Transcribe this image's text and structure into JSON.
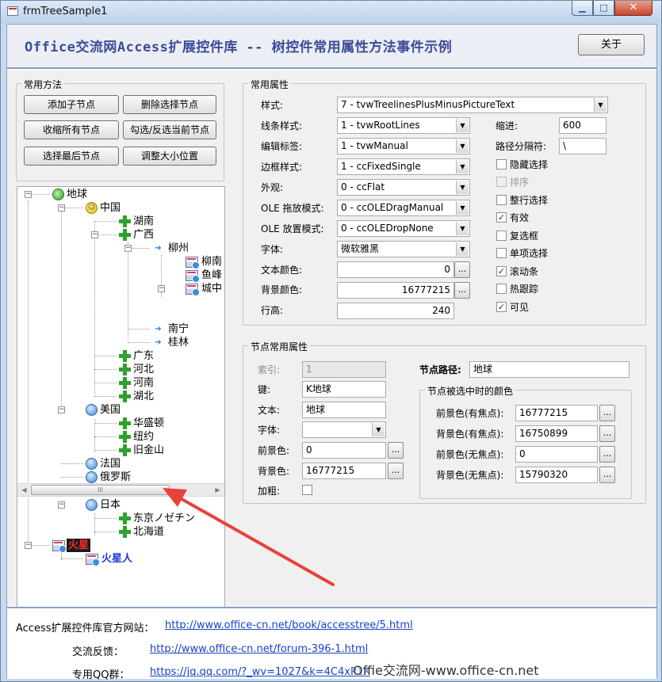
{
  "window": {
    "title": "frmTreeSample1",
    "min_label": "▁",
    "max_label": "□",
    "close_label": "✕"
  },
  "header": {
    "title": "Office交流网Access扩展控件库 -- 树控件常用属性方法事件示例",
    "close_button": "关于"
  },
  "methods": {
    "legend": "常用方法",
    "buttons": [
      "添加子节点",
      "删除选择节点",
      "收缩所有节点",
      "勾选/反选当前节点",
      "选择最后节点",
      "调整大小位置"
    ]
  },
  "tree": {
    "nodes": [
      {
        "label": "地球",
        "icon": "earth-icon",
        "expander": "−"
      },
      {
        "label": "中国",
        "icon": "smile-icon",
        "expander": "−"
      },
      {
        "label": "湖南",
        "icon": "plus-icon"
      },
      {
        "label": "广西",
        "icon": "plus-icon",
        "expander": "−"
      },
      {
        "label": "柳州",
        "icon": "arrow-icon",
        "expander": "−"
      },
      {
        "label": "柳南",
        "icon": "picture-icon"
      },
      {
        "label": "鱼峰",
        "icon": "picture-icon"
      },
      {
        "label": "城中",
        "icon": "picture-icon",
        "expander": "−"
      },
      {
        "label": "南宁",
        "icon": "arrow-icon"
      },
      {
        "label": "桂林",
        "icon": "arrow-icon"
      },
      {
        "label": "广东",
        "icon": "plus-icon"
      },
      {
        "label": "河北",
        "icon": "plus-icon"
      },
      {
        "label": "河南",
        "icon": "plus-icon"
      },
      {
        "label": "湖北",
        "icon": "plus-icon"
      },
      {
        "label": "美国",
        "icon": "globe-icon",
        "expander": "−"
      },
      {
        "label": "华盛顿",
        "icon": "plus-icon"
      },
      {
        "label": "纽约",
        "icon": "plus-icon"
      },
      {
        "label": "旧金山",
        "icon": "plus-icon"
      },
      {
        "label": "法国",
        "icon": "globe-icon"
      },
      {
        "label": "俄罗斯",
        "icon": "globe-icon"
      },
      {
        "label": "日本",
        "icon": "globe-icon",
        "expander": "−"
      },
      {
        "label": "东京ノゼチン",
        "icon": "plus-icon"
      },
      {
        "label": "北海道",
        "icon": "plus-icon"
      },
      {
        "label": "火星",
        "icon": "picture-icon",
        "expander": "−"
      },
      {
        "label": "火星人",
        "icon": "picture-icon"
      }
    ],
    "scroll_grip": "III",
    "scroll_left": "◀",
    "scroll_right": "▶"
  },
  "props": {
    "legend": "常用属性",
    "style_label": "样式:",
    "style_value": "7 - tvwTreelinesPlusMinusPictureText",
    "line_style_label": "线条样式:",
    "line_style_value": "1 - tvwRootLines",
    "label_edit_label": "编辑标签:",
    "label_edit_value": "1 - tvwManual",
    "border_label": "边框样式:",
    "border_value": "1 - ccFixedSingle",
    "appearance_label": "外观:",
    "appearance_value": "0 - ccFlat",
    "ole_drag_label": "OLE 拖放模式:",
    "ole_drag_value": "0 - ccOLEDragManual",
    "ole_drop_label": "OLE 放置模式:",
    "ole_drop_value": "0 - ccOLEDropNone",
    "font_label": "字体:",
    "font_value": "微软雅黑",
    "forecolor_label": "文本颜色:",
    "forecolor_value": "0",
    "backcolor_label": "背景颜色:",
    "backcolor_value": "16777215",
    "rowheight_label": "行高:",
    "rowheight_value": "240",
    "indent_label": "缩进:",
    "indent_value": "600",
    "separator_label": "路径分隔符:",
    "separator_value": "\\",
    "ellipsis": "...",
    "checkboxes": [
      {
        "label": "隐藏选择",
        "checked": false,
        "disabled": false
      },
      {
        "label": "排序",
        "checked": false,
        "disabled": true
      },
      {
        "label": "整行选择",
        "checked": false,
        "disabled": false
      },
      {
        "label": "有效",
        "checked": true,
        "disabled": false
      },
      {
        "label": "复选框",
        "checked": false,
        "disabled": false
      },
      {
        "label": "单项选择",
        "checked": false,
        "disabled": false
      },
      {
        "label": "滚动条",
        "checked": true,
        "disabled": false
      },
      {
        "label": "热跟踪",
        "checked": false,
        "disabled": false
      },
      {
        "label": "可见",
        "checked": true,
        "disabled": false
      }
    ]
  },
  "node": {
    "legend": "节点常用属性",
    "index_label": "索引:",
    "index_value": "1",
    "key_label": "键:",
    "key_value": "K地球",
    "text_label": "文本:",
    "text_value": "地球",
    "font_label": "字体:",
    "font_value": "",
    "fore_label": "前景色:",
    "fore_value": "0",
    "back_label": "背景色:",
    "back_value": "16777215",
    "bold_label": "加粗:",
    "path_label": "节点路径:",
    "path_value": "地球",
    "selected_colors": {
      "legend": "节点被选中时的颜色",
      "fg_focus_label": "前景色(有焦点):",
      "fg_focus_value": "16777215",
      "bg_focus_label": "背景色(有焦点):",
      "bg_focus_value": "16750899",
      "fg_nofocus_label": "前景色(无焦点):",
      "fg_nofocus_value": "0",
      "bg_nofocus_label": "背景色(无焦点):",
      "bg_nofocus_value": "15790320"
    }
  },
  "footer": {
    "site_label": "Access扩展控件库官方网站：",
    "site_url": "http://www.office-cn.net/book/accesstree/5.html",
    "feedback_label": "交流反馈：",
    "feedback_url": "http://www.office-cn.net/forum-396-1.html",
    "qq_label": "专用QQ群：",
    "qq_url": "https://jq.qq.com/?_wv=1027&k=4C4xP1X"
  },
  "watermark": "Offie交流网-www.office-cn.net",
  "colors": {
    "title_blue": "#3a4d97",
    "link_blue": "#1a3fc8",
    "annotation_red": "#e8413a"
  }
}
